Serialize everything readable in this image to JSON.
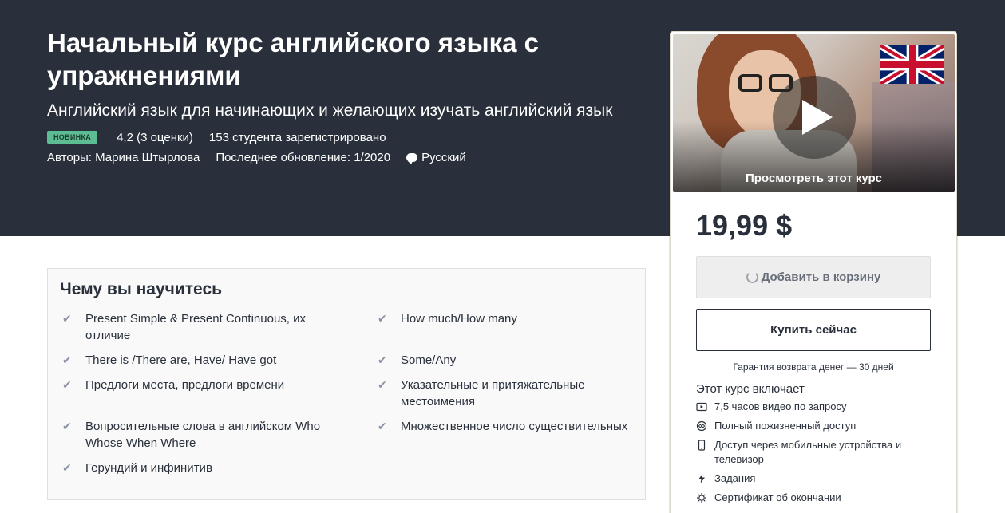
{
  "course": {
    "title": "Начальный курс английского языка с упражнениями",
    "subtitle": "Английский язык для начинающих и желающих изучать английский язык",
    "badge": "НОВИНКА",
    "rating": "4,2 (3 оценки)",
    "students": "153 студента зарегистрировано",
    "authors": "Авторы: Марина Штырлова",
    "updated": "Последнее обновление: 1/2020",
    "language": "Русский"
  },
  "sidebar": {
    "preview_label": "Просмотреть этот курс",
    "price": "19,99 $",
    "add_to_cart": "Добавить в корзину",
    "buy_now": "Купить сейчас",
    "guarantee": "Гарантия возврата денег — 30 дней",
    "includes_title": "Этот курс включает",
    "includes": [
      {
        "icon": "video-icon",
        "text": "7,5 часов видео по запросу"
      },
      {
        "icon": "infinity-icon",
        "text": "Полный пожизненный доступ"
      },
      {
        "icon": "mobile-icon",
        "text": "Доступ через мобильные устройства и телевизор"
      },
      {
        "icon": "lightning-icon",
        "text": "Задания"
      },
      {
        "icon": "certificate-icon",
        "text": "Сертификат об окончании"
      }
    ]
  },
  "learn": {
    "title": "Чему вы научитесь",
    "left": [
      "Present Simple & Present Continuous, их отличие",
      "There is /There are, Have/ Have got",
      "Предлоги места, предлоги времени",
      "Вопросительные слова в английском Who Whose When Where",
      "Герундий и инфинитив"
    ],
    "right": [
      "How much/How many",
      "Some/Any",
      "Указательные и притяжательные местоимения",
      "Множественное число существительных"
    ]
  },
  "colors": {
    "hero_bg": "#29303b",
    "badge_bg": "#5bbd91",
    "check": "#8a92a3"
  }
}
